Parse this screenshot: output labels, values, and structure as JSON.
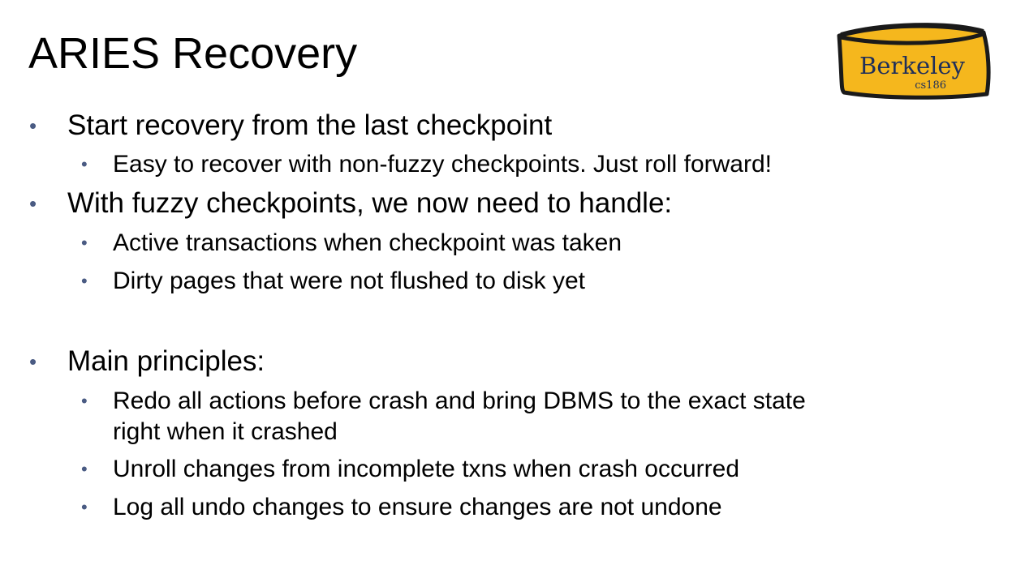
{
  "slide": {
    "title": "ARIES Recovery",
    "logo": {
      "name": "Berkeley",
      "course": "cs186",
      "colors": {
        "fill": "#f5b71d",
        "outline": "#1a1a1a",
        "text": "#1f2f5a"
      }
    },
    "bullet_glyph": "•",
    "bullet_color": "#4a5b83",
    "bullets": [
      {
        "level": 1,
        "text": "Start recovery from the last checkpoint"
      },
      {
        "level": 2,
        "text": "Easy to recover with non-fuzzy checkpoints. Just roll forward!"
      },
      {
        "level": 1,
        "text": "With fuzzy checkpoints, we now need to handle:"
      },
      {
        "level": 2,
        "text": "Active transactions when checkpoint was taken"
      },
      {
        "level": 2,
        "text": "Dirty pages that were not flushed to disk yet"
      },
      {
        "level": 1,
        "text": "Main principles:"
      },
      {
        "level": 2,
        "text": "Redo all actions before crash and bring DBMS to the exact state"
      },
      {
        "level": 2,
        "text": "right when it crashed",
        "continuation": true
      },
      {
        "level": 2,
        "text": "Unroll changes from incomplete txns when crash occurred"
      },
      {
        "level": 2,
        "text": "Log all undo changes to ensure changes are not undone"
      }
    ]
  }
}
